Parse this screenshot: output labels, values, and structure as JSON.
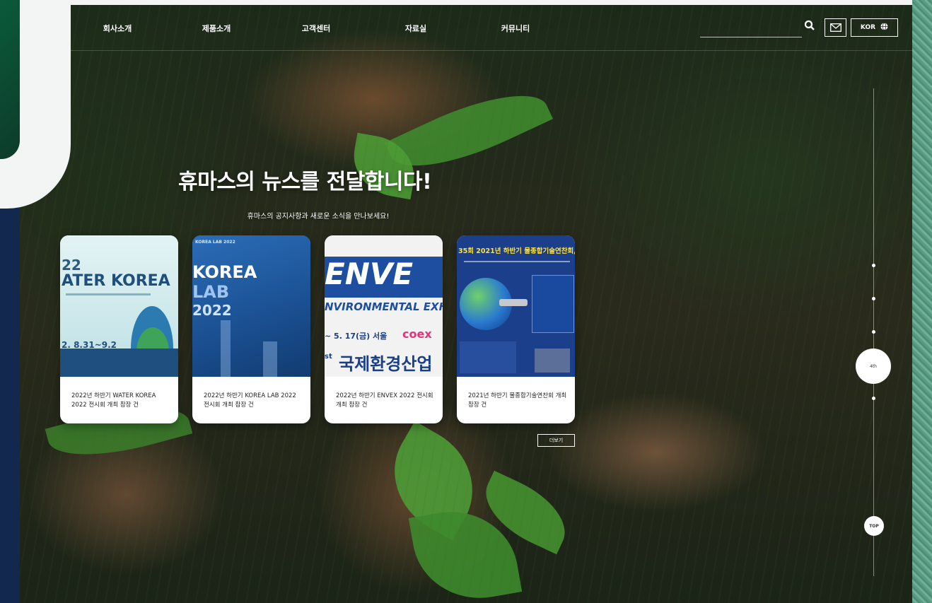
{
  "nav": {
    "items": [
      "회사소개",
      "제품소개",
      "고객센터",
      "자료실",
      "커뮤니티"
    ],
    "lang_label": "KOR",
    "search_placeholder": ""
  },
  "hero": {
    "headline": "휴마스의 뉴스를 전달합니다!",
    "subline": "휴마스의 공지사항과 새로운 소식을 만나보세요!"
  },
  "cards": [
    {
      "caption": "2022년 하반기 WATER KOREA 2022 전시회 개최 참장 건",
      "poster": {
        "line1": "22",
        "line2": "ATER KOREA",
        "date": "2. 8.31~9.2",
        "bg": "#b9dee3",
        "accent": "#1f4f7e"
      }
    },
    {
      "caption": "2022년 하반기 KOREA LAB 2022 전시회 개최 참장 건",
      "poster": {
        "tag": "KOREA LAB 2022",
        "line1": "KOREA",
        "line2": "LAB",
        "line3": "2022",
        "bg": "#1f5da6"
      }
    },
    {
      "caption": "2022년 하반기 ENVEX 2022 전시회 개최 참장 건",
      "poster": {
        "line1": "ENVE",
        "line2": "NVIRONMENTAL EXHI",
        "date": "~ 5. 17(금) 서울",
        "brand": "coex",
        "line3": "국제환경산업",
        "prefix": "st"
      }
    },
    {
      "caption": "2021년 하반기 물종합기술연찬회 개최 참장 건",
      "poster": {
        "title": "35회 2021년 하반기 물종합기술연찬회,"
      }
    }
  ],
  "more_label": "더보기",
  "rail": {
    "active_label": "4th",
    "top_label": "TOP"
  },
  "colors": {
    "accent": "#1f5da6",
    "left_strip": "#13284f",
    "right_strip": "#5a9b83"
  }
}
